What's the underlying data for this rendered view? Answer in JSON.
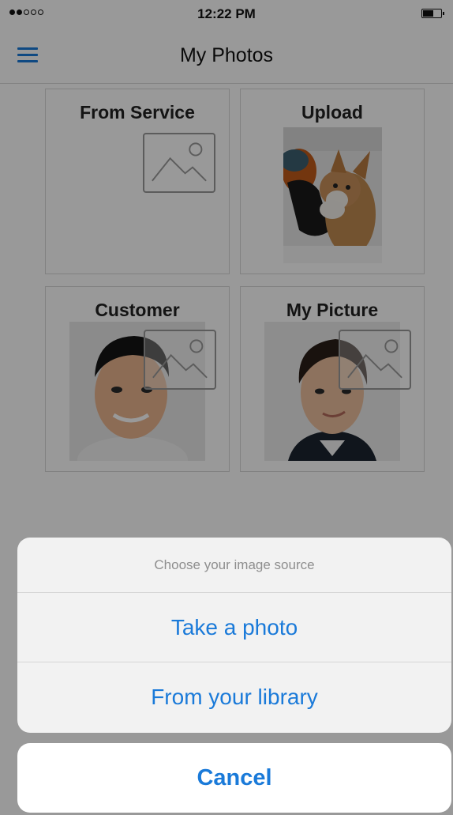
{
  "status_bar": {
    "time": "12:22 PM",
    "signal_dots_filled": 2,
    "signal_dots_total": 5,
    "battery_level": 0.55
  },
  "nav": {
    "title": "My Photos",
    "menu_icon": "hamburger-menu-icon"
  },
  "tiles": [
    {
      "label": "From Service",
      "content": "image-placeholder-icon"
    },
    {
      "label": "Upload",
      "content": "puppy-photo"
    },
    {
      "label": "Customer",
      "content": "man-portrait-photo"
    },
    {
      "label": "My Picture",
      "content": "young-man-portrait-photo"
    }
  ],
  "action_sheet": {
    "title": "Choose your image source",
    "options": [
      "Take a photo",
      "From your library"
    ],
    "cancel": "Cancel"
  },
  "colors": {
    "accent": "#1a7ad9",
    "overlay": "rgba(0,0,0,0.40)"
  }
}
